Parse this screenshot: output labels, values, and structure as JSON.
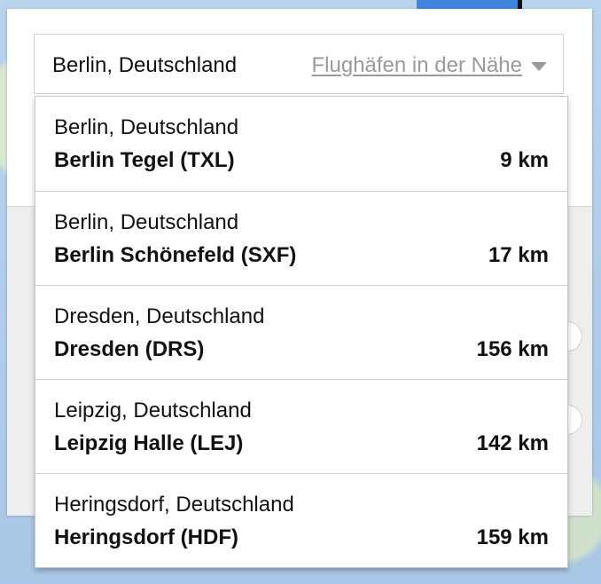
{
  "search": {
    "value": "Berlin, Deutschland",
    "nearby_label": "Flughäfen in der Nähe",
    "nearby_icon": "chevron-down-icon"
  },
  "airports": [
    {
      "city": "Berlin, Deutschland",
      "name": "Berlin Tegel (TXL)",
      "distance": "9 km"
    },
    {
      "city": "Berlin, Deutschland",
      "name": "Berlin Schönefeld (SXF)",
      "distance": "17 km"
    },
    {
      "city": "Dresden, Deutschland",
      "name": "Dresden (DRS)",
      "distance": "156 km"
    },
    {
      "city": "Leipzig, Deutschland",
      "name": "Leipzig Halle (LEJ)",
      "distance": "142 km"
    },
    {
      "city": "Heringsdorf, Deutschland",
      "name": "Heringsdorf (HDF)",
      "distance": "159 km"
    }
  ],
  "colors": {
    "text": "#111111",
    "muted": "#9a9a9a",
    "border": "#cfcfcf",
    "map_water": "#b9d4ec",
    "map_accent": "#3f86e0"
  }
}
